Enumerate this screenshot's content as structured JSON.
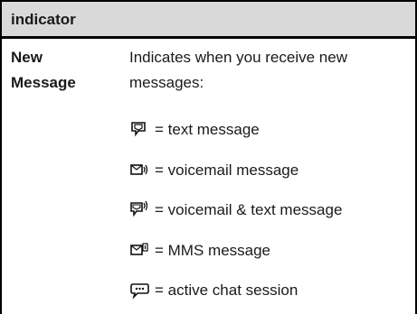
{
  "table": {
    "header": "indicator",
    "term": [
      "New",
      "Message"
    ],
    "description": [
      "Indicates when you receive new",
      "messages:"
    ],
    "items": [
      {
        "icon": "text-message-icon",
        "label": "= text message"
      },
      {
        "icon": "voicemail-icon",
        "label": "= voicemail message"
      },
      {
        "icon": "voicemail-text-icon",
        "label": "= voicemail & text message"
      },
      {
        "icon": "mms-icon",
        "label": "= MMS message"
      },
      {
        "icon": "chat-icon",
        "label": "= active chat session"
      }
    ]
  }
}
